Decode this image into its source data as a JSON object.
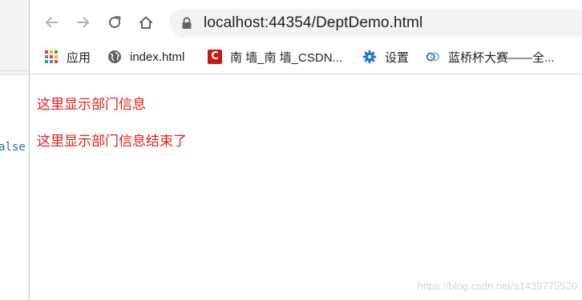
{
  "background_editor": {
    "code_fragment": "alse"
  },
  "toolbar": {
    "back_icon": "arrow-left-icon",
    "forward_icon": "arrow-right-icon",
    "reload_icon": "reload-icon",
    "home_icon": "home-icon"
  },
  "omnibox": {
    "url": "localhost:44354/DeptDemo.html",
    "lock_icon": "lock-icon"
  },
  "bookmarks": [
    {
      "label": "应用",
      "icon": "apps-grid-icon"
    },
    {
      "label": "index.html",
      "icon": "globe-icon"
    },
    {
      "label": "南 墙_南 墙_CSDN...",
      "icon": "csdn-icon"
    },
    {
      "label": "设置",
      "icon": "gear-icon"
    },
    {
      "label": "蓝桥杯大赛——全...",
      "icon": "lanqiao-icon"
    }
  ],
  "csdn_icon_letter": "C",
  "page": {
    "line1": "这里显示部门信息",
    "line2": "这里显示部门信息结束了",
    "text_color": "#e0201a"
  },
  "watermark": "https://blog.csdn.net/a1439775520",
  "colors": {
    "icon_gray": "#5f6368",
    "omnibox_bg": "#f1f3f4",
    "gear_blue": "#1a73e8",
    "csdn_red": "#c9170f"
  }
}
